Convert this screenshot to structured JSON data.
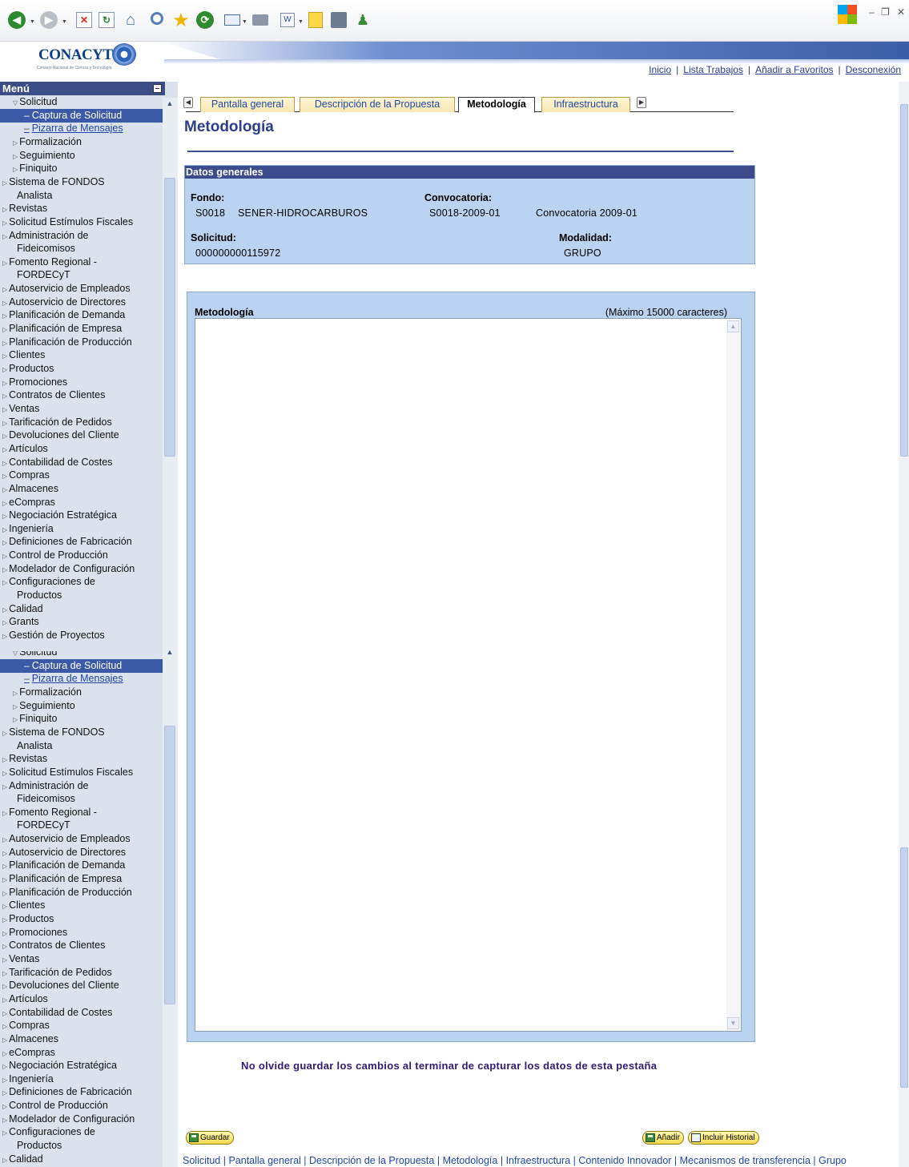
{
  "browser_toolbar": {
    "buttons": [
      {
        "name": "back-icon"
      },
      {
        "name": "forward-icon"
      },
      {
        "name": "stop-icon"
      },
      {
        "name": "refresh-icon"
      },
      {
        "name": "home-icon"
      },
      {
        "name": "search-icon"
      },
      {
        "name": "favorites-icon"
      },
      {
        "name": "history-icon"
      },
      {
        "name": "mail-icon"
      },
      {
        "name": "print-icon"
      },
      {
        "name": "edit-icon"
      },
      {
        "name": "notes-icon"
      },
      {
        "name": "research-icon"
      },
      {
        "name": "messenger-icon"
      }
    ]
  },
  "header": {
    "logo_text": "CONACYT",
    "logo_subtitle": "Consejo Nacional de Ciencia y Tecnología",
    "links": [
      "Inicio",
      "Lista Trabajos",
      "Añadir a Favoritos",
      "Desconexión"
    ]
  },
  "menu": {
    "title": "Menú",
    "items": [
      {
        "label": "Solicitud",
        "level": 1,
        "expanded": true
      },
      {
        "label": "Captura de Solicitud",
        "level": 2,
        "selected": true
      },
      {
        "label": "Pizarra de Mensajes",
        "level": 2,
        "link": true
      },
      {
        "label": "Formalización",
        "level": 1
      },
      {
        "label": "Seguimiento",
        "level": 1
      },
      {
        "label": "Finiquito",
        "level": 1
      },
      {
        "label": "Sistema de FONDOS",
        "level": 0
      },
      {
        "label": "Analista",
        "level": 0,
        "cont": true
      },
      {
        "label": "Revistas",
        "level": 0
      },
      {
        "label": "Solicitud Estímulos Fiscales",
        "level": 0
      },
      {
        "label": "Administración de",
        "level": 0
      },
      {
        "label": "Fideicomisos",
        "level": 0,
        "cont": true
      },
      {
        "label": "Fomento Regional -",
        "level": 0
      },
      {
        "label": "FORDECyT",
        "level": 0,
        "cont": true
      },
      {
        "label": "Autoservicio de Empleados",
        "level": 0
      },
      {
        "label": "Autoservicio de Directores",
        "level": 0
      },
      {
        "label": "Planificación de Demanda",
        "level": 0
      },
      {
        "label": "Planificación de Empresa",
        "level": 0
      },
      {
        "label": "Planificación de Producción",
        "level": 0
      },
      {
        "label": "Clientes",
        "level": 0
      },
      {
        "label": "Productos",
        "level": 0
      },
      {
        "label": "Promociones",
        "level": 0
      },
      {
        "label": "Contratos de Clientes",
        "level": 0
      },
      {
        "label": "Ventas",
        "level": 0
      },
      {
        "label": "Tarificación de Pedidos",
        "level": 0
      },
      {
        "label": "Devoluciones del Cliente",
        "level": 0
      },
      {
        "label": "Artículos",
        "level": 0
      },
      {
        "label": "Contabilidad de Costes",
        "level": 0
      },
      {
        "label": "Compras",
        "level": 0
      },
      {
        "label": "Almacenes",
        "level": 0
      },
      {
        "label": "eCompras",
        "level": 0
      },
      {
        "label": "Negociación Estratégica",
        "level": 0
      },
      {
        "label": "Ingeniería",
        "level": 0
      },
      {
        "label": "Definiciones de Fabricación",
        "level": 0
      },
      {
        "label": "Control de Producción",
        "level": 0
      },
      {
        "label": "Modelador de Configuración",
        "level": 0
      },
      {
        "label": "Configuraciones de",
        "level": 0
      },
      {
        "label": "Productos",
        "level": 0,
        "cont": true
      },
      {
        "label": "Calidad",
        "level": 0
      },
      {
        "label": "Grants",
        "level": 0
      },
      {
        "label": "Gestión de Proyectos",
        "level": 0
      }
    ]
  },
  "tabs": {
    "items": [
      {
        "label": "Pantalla general",
        "active": false
      },
      {
        "label": "Descripción de la Propuesta",
        "active": false
      },
      {
        "label": "Metodología",
        "active": true
      },
      {
        "label": "Infraestructura",
        "active": false
      }
    ]
  },
  "page": {
    "title": "Metodología"
  },
  "datos_generales": {
    "heading": "Datos generales",
    "fondo_label": "Fondo:",
    "fondo_code": "S0018",
    "fondo_name": "SENER-HIDROCARBUROS",
    "convocatoria_label": "Convocatoria:",
    "convocatoria_code": "S0018-2009-01",
    "convocatoria_name": "Convocatoria 2009-01",
    "solicitud_label": "Solicitud:",
    "solicitud_value": "000000000115972",
    "modalidad_label": "Modalidad:",
    "modalidad_value": "GRUPO"
  },
  "metodologia": {
    "label": "Metodología",
    "limit": "(Máximo 15000 caracteres)",
    "value": ""
  },
  "reminder": "No olvide guardar los cambios al terminar de capturar los datos de esta pestaña",
  "actions": {
    "save": "Guardar",
    "add": "Añadir",
    "history": "Incluir Historial"
  },
  "bottom_links": [
    "Solicitud",
    "Pantalla general",
    "Descripción de la Propuesta",
    "Metodología",
    "Infraestructura",
    "Contenido Innovador",
    "Mecanismos de transferencia",
    "Grupo"
  ]
}
